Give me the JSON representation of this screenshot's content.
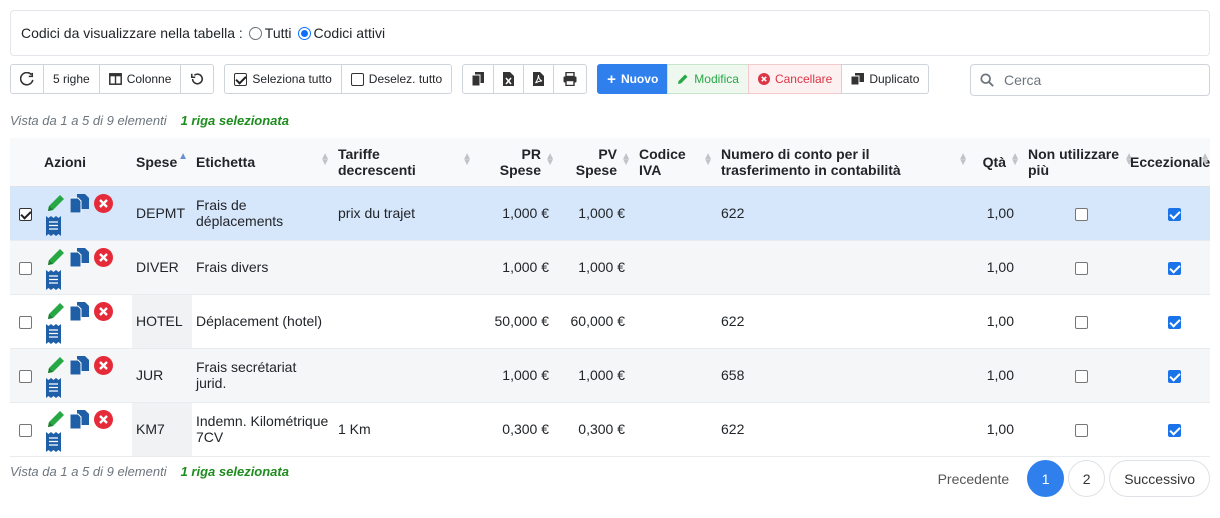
{
  "filter": {
    "label": "Codici da visualizzare nella tabella :",
    "option_all": "Tutti",
    "option_active": "Codici attivi",
    "selected": "Codici attivi"
  },
  "toolbar": {
    "rows_label": "5 righe",
    "columns_label": "Colonne",
    "select_all_label": "Seleziona tutto",
    "deselect_all_label": "Deselez. tutto",
    "new_label": "Nuovo",
    "edit_label": "Modifica",
    "delete_label": "Cancellare",
    "duplicate_label": "Duplicato"
  },
  "search": {
    "placeholder": "Cerca",
    "value": ""
  },
  "info": {
    "range_text": "Vista da 1 a 5 di 9 elementi",
    "selected_text": "1 riga selezionata"
  },
  "table": {
    "headers": {
      "azioni": "Azioni",
      "spese": "Spese",
      "etichetta": "Etichetta",
      "tariffe": "Tariffe decrescenti",
      "pr_spese": "PR Spese",
      "pv_spese": "PV Spese",
      "codice_iva": "Codice IVA",
      "numero_conto": "Numero di conto per il trasferimento in contabilità",
      "qta": "Qtà",
      "non_utilizzare": "Non utilizzare più",
      "eccezionale": "Eccezionale"
    },
    "rows": [
      {
        "selected": true,
        "code": "DEPMT",
        "label": "Frais de déplacements",
        "tariffe": "prix du trajet",
        "pr": "1,000 €",
        "pv": "1,000 €",
        "iva": "",
        "conto": "622",
        "qta": "1,00",
        "non_utilizzare": false,
        "eccezionale": true
      },
      {
        "selected": false,
        "code": "DIVER",
        "label": "Frais divers",
        "tariffe": "",
        "pr": "1,000 €",
        "pv": "1,000 €",
        "iva": "",
        "conto": "",
        "qta": "1,00",
        "non_utilizzare": false,
        "eccezionale": true
      },
      {
        "selected": false,
        "code": "HOTEL",
        "label": "Déplacement (hotel)",
        "tariffe": "",
        "pr": "50,000 €",
        "pv": "60,000 €",
        "iva": "",
        "conto": "622",
        "qta": "1,00",
        "non_utilizzare": false,
        "eccezionale": true
      },
      {
        "selected": false,
        "code": "JUR",
        "label": "Frais secrétariat jurid.",
        "tariffe": "",
        "pr": "1,000 €",
        "pv": "1,000 €",
        "iva": "",
        "conto": "658",
        "qta": "1,00",
        "non_utilizzare": false,
        "eccezionale": true
      },
      {
        "selected": false,
        "code": "KM7",
        "label": "Indemn. Kilométrique 7CV",
        "tariffe": "1 Km",
        "pr": "0,300 €",
        "pv": "0,300 €",
        "iva": "",
        "conto": "622",
        "qta": "1,00",
        "non_utilizzare": false,
        "eccezionale": true
      }
    ]
  },
  "pagination": {
    "prev_label": "Precedente",
    "pages": [
      "1",
      "2"
    ],
    "current": "1",
    "next_label": "Successivo"
  },
  "colors": {
    "primary": "#2f80ed",
    "edit_icon": "#28a745",
    "delete_icon": "#dc3545",
    "doc_icon": "#1f5fa8",
    "selection_text": "#1e8c1e"
  }
}
